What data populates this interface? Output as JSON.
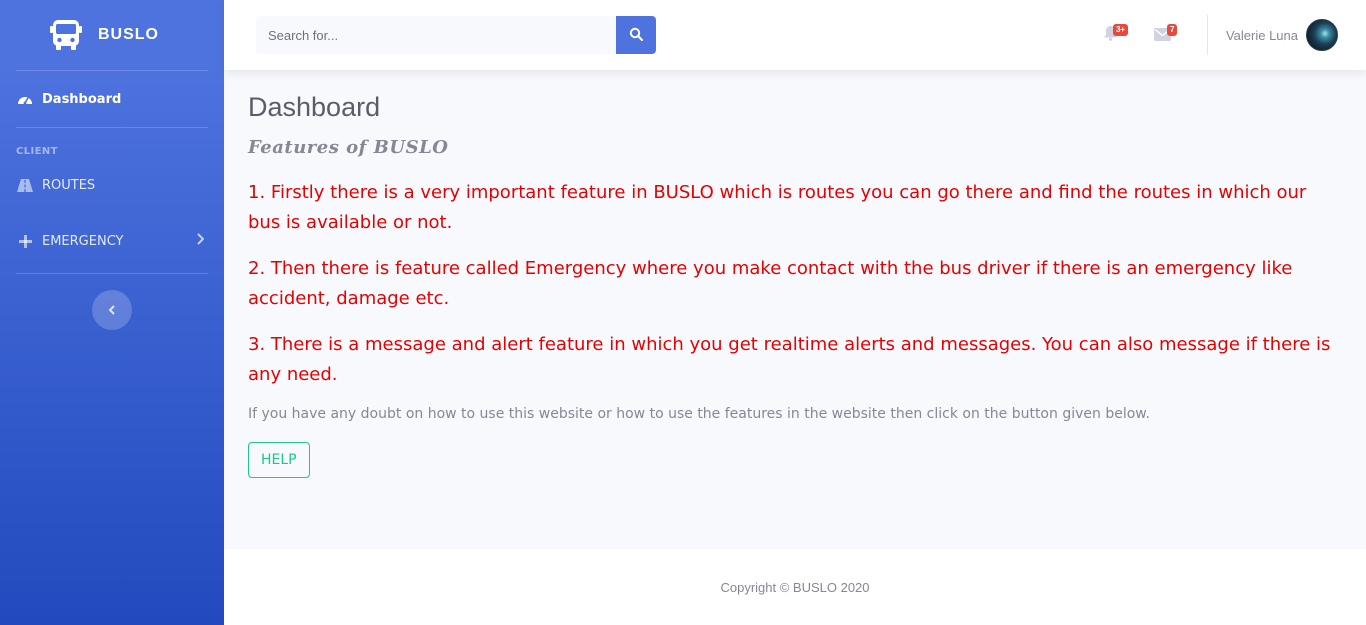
{
  "brand": {
    "name": "BUSLO",
    "icon": "bus-icon"
  },
  "sidebar": {
    "items": [
      {
        "label": "Dashboard",
        "icon": "tachometer-icon",
        "active": true
      }
    ],
    "heading": "CLIENT",
    "client_items": [
      {
        "label": "ROUTES",
        "icon": "road-icon"
      },
      {
        "label": "EMERGENCY",
        "icon": "plus-icon",
        "has_submenu": true
      }
    ],
    "toggle_icon": "chevron-left-icon"
  },
  "topbar": {
    "search_placeholder": "Search for...",
    "search_icon": "search-icon",
    "alerts_badge": "3+",
    "messages_badge": "7",
    "user_name": "Valerie Luna"
  },
  "main": {
    "title": "Dashboard",
    "features_heading": "Features of BUSLO",
    "features": [
      "1. Firstly there is a very important feature in BUSLO which is routes you can go there and find the routes in which our bus is available or not.",
      "2. Then there is feature called Emergency where you make contact with the bus driver if there is an emergency like accident, damage etc.",
      "3. There is a message and alert feature in which you get realtime alerts and messages. You can also message if there is any need."
    ],
    "note": "If you have any doubt on how to use this website or how to use the features in the website then click on the button given below.",
    "help_label": "HELP"
  },
  "footer": {
    "copyright": "Copyright © BUSLO 2020"
  },
  "colors": {
    "primary": "#4e73df",
    "feature_text": "#e60000",
    "help": "#1cc88a",
    "badge": "#e74a3b"
  }
}
